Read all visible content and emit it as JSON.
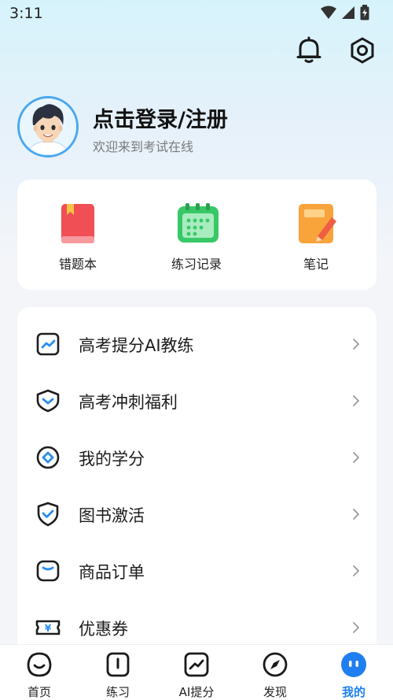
{
  "status_bar": {
    "time": "3:11"
  },
  "header": {
    "notification_icon": "bell-icon",
    "settings_icon": "settings-icon"
  },
  "profile": {
    "title": "点击登录/注册",
    "subtitle": "欢迎来到考试在线"
  },
  "tools": [
    {
      "label": "错题本",
      "icon": "red-book-icon"
    },
    {
      "label": "练习记录",
      "icon": "green-calendar-icon"
    },
    {
      "label": "笔记",
      "icon": "orange-notebook-icon"
    }
  ],
  "menu": [
    {
      "label": "高考提分AI教练",
      "icon": "trend-chart-icon"
    },
    {
      "label": "高考冲刺福利",
      "icon": "gift-shield-icon"
    },
    {
      "label": "我的学分",
      "icon": "credit-coin-icon"
    },
    {
      "label": "图书激活",
      "icon": "check-shield-icon"
    },
    {
      "label": "商品订单",
      "icon": "order-box-icon"
    },
    {
      "label": "优惠券",
      "icon": "coupon-icon"
    }
  ],
  "tabbar": {
    "items": [
      {
        "label": "首页",
        "icon": "home-smile-icon"
      },
      {
        "label": "练习",
        "icon": "practice-icon"
      },
      {
        "label": "AI提分",
        "icon": "ai-chart-icon"
      },
      {
        "label": "发现",
        "icon": "compass-icon"
      },
      {
        "label": "我的",
        "icon": "profile-dots-icon"
      }
    ],
    "active_index": 4,
    "accent_color": "#1f7ff0"
  }
}
